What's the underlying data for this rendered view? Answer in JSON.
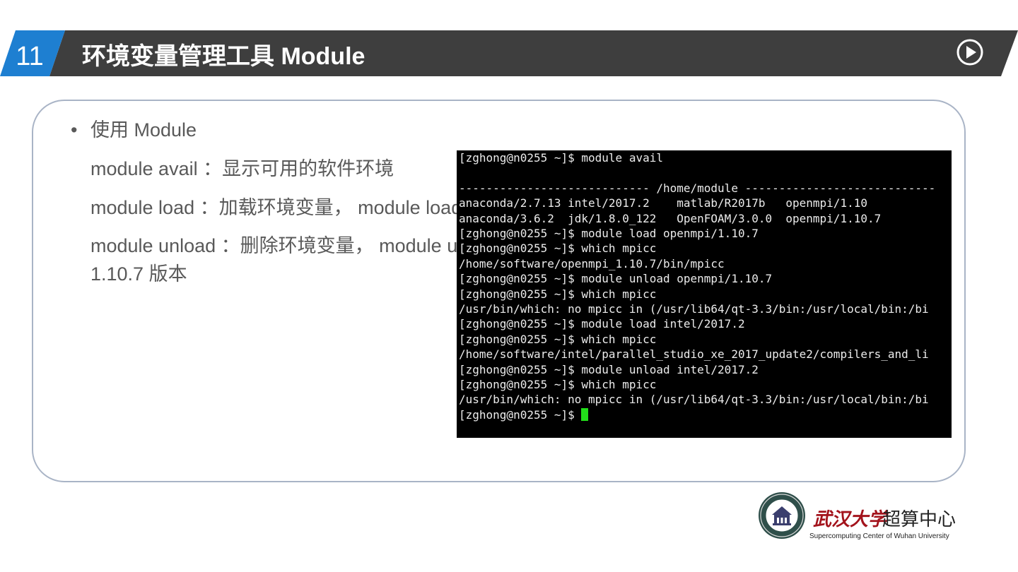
{
  "header": {
    "slide_number": "11",
    "title": "环境变量管理工具 Module",
    "colors": {
      "band": "#3e3e3e",
      "badge": "#1e7fd1"
    }
  },
  "content": {
    "bullet": "使用 Module",
    "lines": [
      "module  avail ：显示可用的软件环境",
      "module   load  ：加载环境变量， module load openmpi/1.10.7",
      "module   unload ：删除环境变量， module unload openmpi/",
      "1.10.7 版本"
    ]
  },
  "terminal": {
    "lines": [
      "[zghong@n0255 ~]$ module avail",
      "",
      "---------------------------- /home/module ----------------------------",
      "anaconda/2.7.13 intel/2017.2    matlab/R2017b   openmpi/1.10",
      "anaconda/3.6.2  jdk/1.8.0_122   OpenFOAM/3.0.0  openmpi/1.10.7",
      "[zghong@n0255 ~]$ module load openmpi/1.10.7",
      "[zghong@n0255 ~]$ which mpicc",
      "/home/software/openmpi_1.10.7/bin/mpicc",
      "[zghong@n0255 ~]$ module unload openmpi/1.10.7",
      "[zghong@n0255 ~]$ which mpicc",
      "/usr/bin/which: no mpicc in (/usr/lib64/qt-3.3/bin:/usr/local/bin:/bi",
      "[zghong@n0255 ~]$ module load intel/2017.2",
      "[zghong@n0255 ~]$ which mpicc",
      "/home/software/intel/parallel_studio_xe_2017_update2/compilers_and_li",
      "[zghong@n0255 ~]$ module unload intel/2017.2",
      "[zghong@n0255 ~]$ which mpicc",
      "/usr/bin/which: no mpicc in (/usr/lib64/qt-3.3/bin:/usr/local/bin:/bi"
    ],
    "prompt": "[zghong@n0255 ~]$ ",
    "cursor_color": "#22e01a"
  },
  "footer": {
    "org_cn_script": "武汉大学",
    "org_cn": "超算中心",
    "org_en": "Supercomputing Center of Wuhan University",
    "logo_icon": "university-seal-icon"
  }
}
